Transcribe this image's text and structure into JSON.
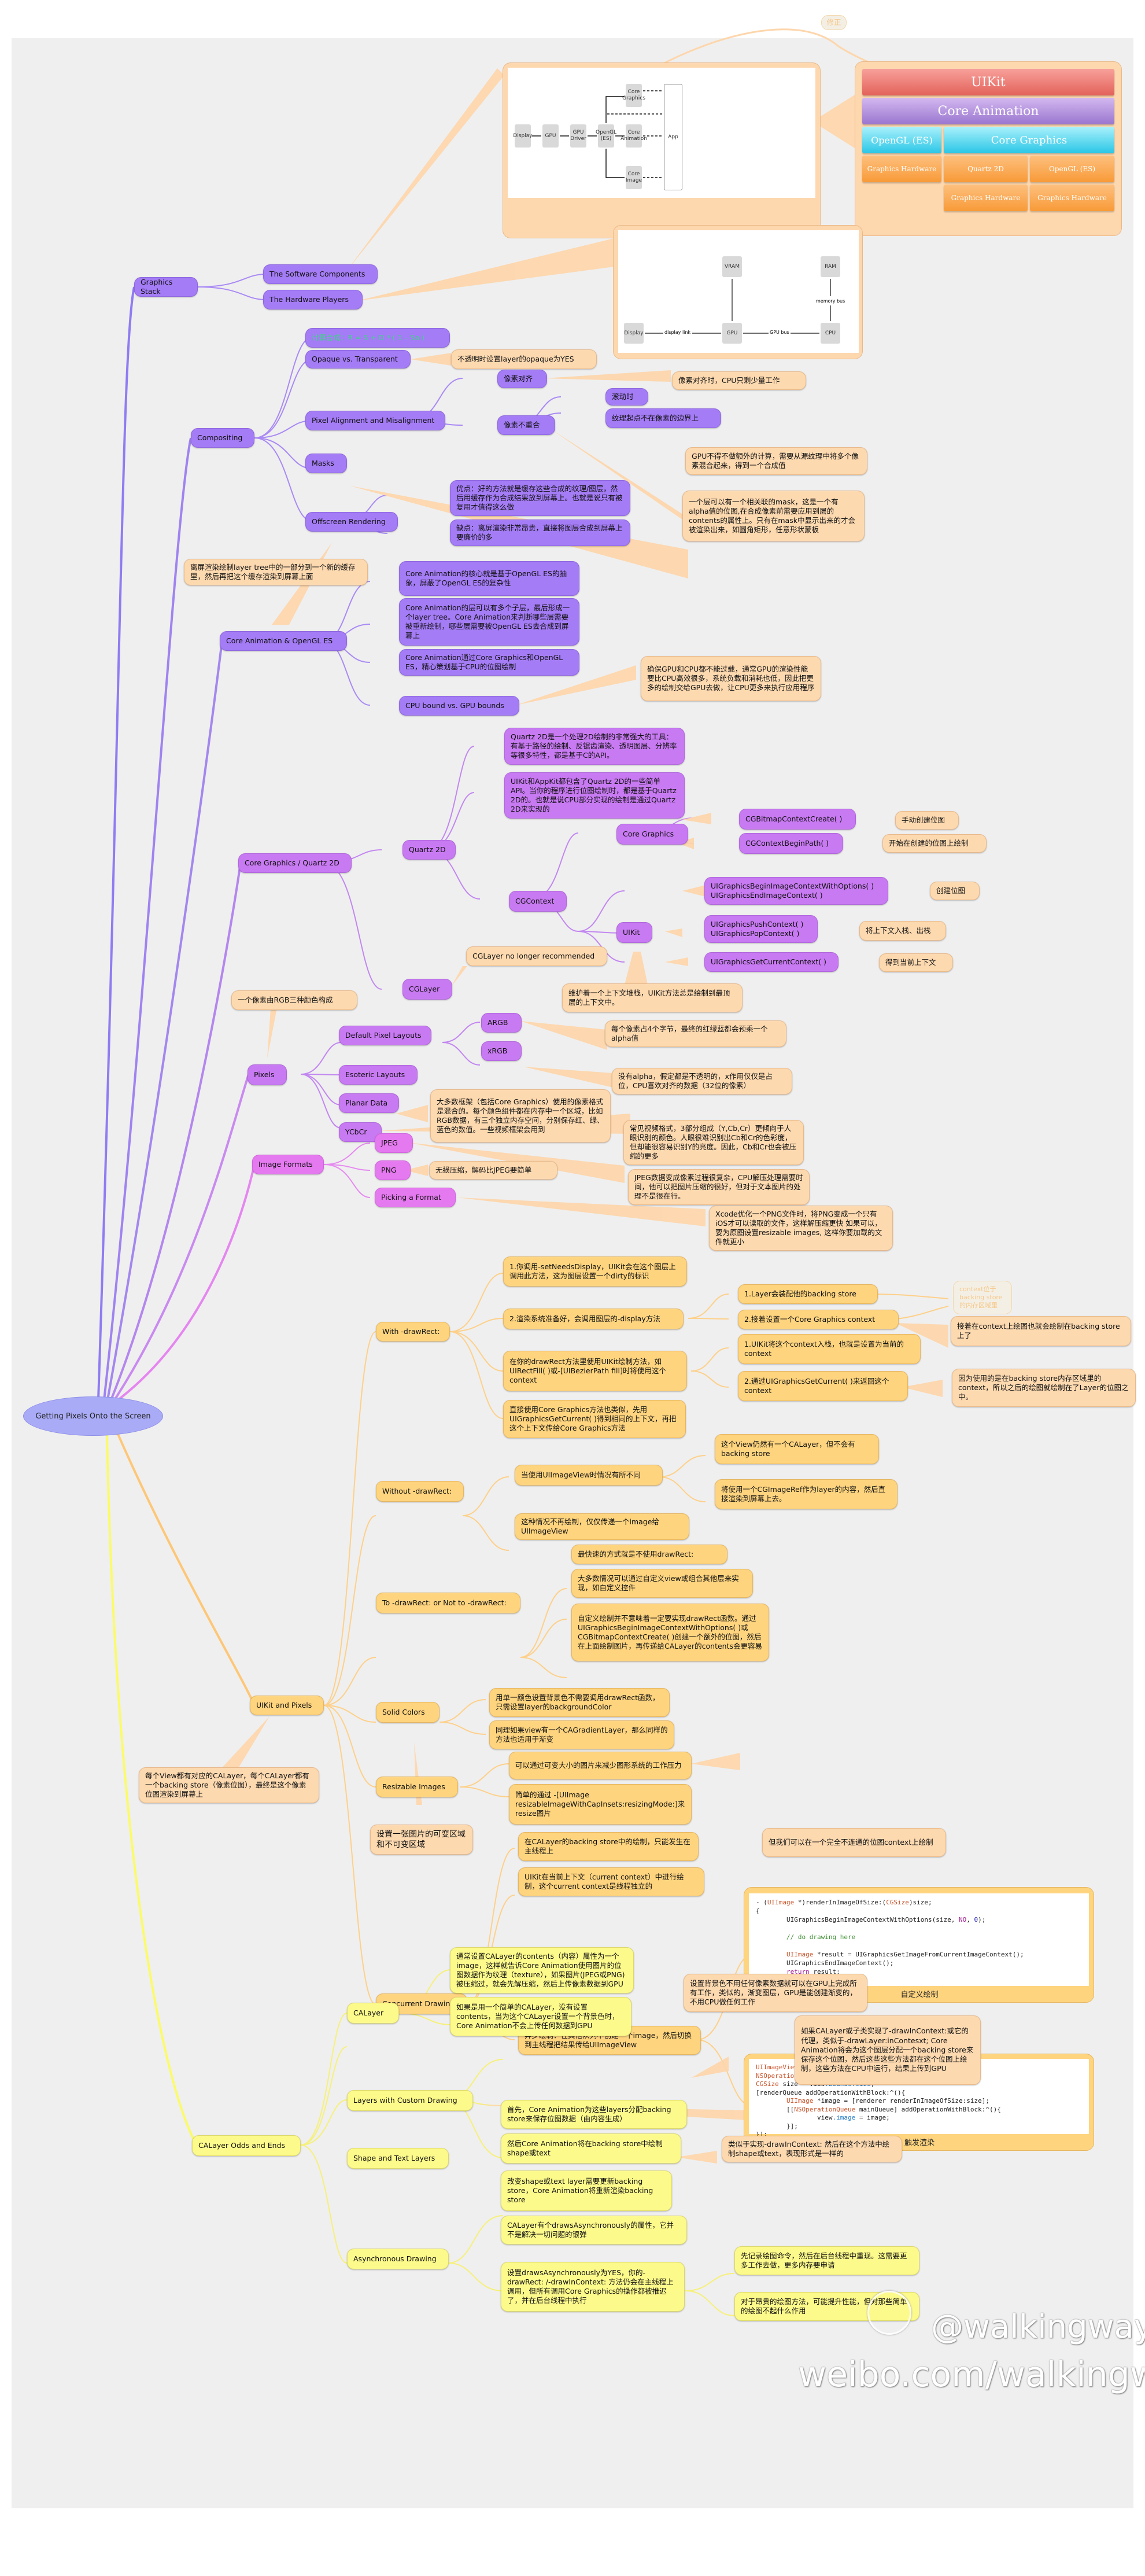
{
  "root": "Getting Pixels Onto the Screen",
  "correction_label": "修正",
  "graphics_stack": {
    "label": "Graphics Stack",
    "software": "The Software Components",
    "hardware": "The Hardware Players",
    "software_diagram": {
      "boxes": [
        "Display",
        "GPU",
        "GPU Driver",
        "OpenGL (ES)",
        "Core Animation",
        "Core Graphics",
        "Core Image",
        "App"
      ]
    },
    "stack_diagram": {
      "uikit": "UIKit",
      "core_animation": "Core Animation",
      "opengl": "OpenGL (ES)",
      "core_graphics": "Core Graphics",
      "gh1": "Graphics Hardware",
      "quartz": "Quartz 2D",
      "opengl2": "OpenGL (ES)",
      "gh2": "Graphics Hardware",
      "gh3": "Graphics Hardware"
    },
    "hardware_diagram": {
      "vram": "VRAM",
      "ram": "RAM",
      "memory_bus": "memory bus",
      "display": "Display",
      "display_link": "display link",
      "gpu": "GPU",
      "gpu_bus": "GPU bus",
      "cpu": "CPU"
    }
  },
  "compositing": {
    "label": "Compositing",
    "formula": "计算合成：R = S + D * ( 1 – Sa )",
    "opaque": "Opaque vs. Transparent",
    "opaque_note": "不透明时设置layer的opaque为YES",
    "pixel_align": "Pixel Alignment and Misalignment",
    "aligned": "像素对齐",
    "aligned_note": "像素对齐时，CPU只剩少量工作",
    "misaligned": "像素不重合",
    "scrolling": "滚动时",
    "texture_edge": "纹理起点不在像素的边界上",
    "misaligned_note": "GPU不得不做额外的计算，需要从源纹理中将多个像素混合起来，得到一个合成值",
    "masks": "Masks",
    "mask_note": "一个层可以有一个相关联的mask，这是一个有alpha值的位图,在合成像素前需要应用到层的contents的属性上。只有在mask中显示出来的才会被渲染出来，如圆角矩形，任意形状蒙板",
    "offscreen": "Offscreen Rendering",
    "offscreen_pro": "优点：好的方法就是缓存这些合成的纹理/图层，然后用缓存作为合成结果放到屏幕上。也就是说只有被复用才值得这么做",
    "offscreen_con": "缺点：离屏渲染非常昂贵，直接将图层合成到屏幕上要廉价的多",
    "offscreen_note": "离屏渲染绘制layer tree中的一部分到一个新的缓存里，然后再把这个缓存渲染到屏幕上面"
  },
  "ca_opengl": {
    "label": "Core Animation & OpenGL ES",
    "item1": "Core Animation的核心就是基于OpenGL ES的抽象，屏蔽了OpenGL ES的复杂性",
    "item2": "Core Animation的层可以有多个子层，最后形成一个layer tree。Core Animation来判断哪些层需要被重新绘制，哪些层需要被OpenGL ES去合成到屏幕上",
    "item3": "Core Animation通过Core Graphics和OpenGL ES，精心策划基于CPU的位图绘制",
    "bound": "CPU bound vs. GPU bounds",
    "bound_note": "确保GPU和CPU都不能过载，通常GPU的渲染性能要比CPU高效很多，系统负载和消耗也低，因此把更多的绘制交给GPU去做，让CPU更多来执行应用程序"
  },
  "core_graphics": {
    "label": "Core Graphics / Quartz 2D",
    "quartz": "Quartz 2D",
    "quartz_note1": "Quartz 2D是一个处理2D绘制的非常强大的工具：有基于路径的绘制、反锯齿渲染、透明图层、分辨率等很多特性，都是基于C的API。",
    "quartz_note2": "UIKit和AppKit都包含了Quartz 2D的一些简单API。当你的程序进行位图绘制时，都是基于Quartz 2D的。也就是说CPU部分实现的绘制是通过Quartz 2D来实现的",
    "cgcontext": "CGContext",
    "cg": "Core Graphics",
    "cg_fn1": "CGBitmapContextCreate( )",
    "cg_fn1_note": "手动创建位图",
    "cg_fn2": "CGContextBeginPath( )",
    "cg_fn2_note": "开始在创建的位图上绘制",
    "uikit": "UIKit",
    "uikit_fn1a": "UIGraphicsBeginImageContextWithOptions( )",
    "uikit_fn1b": "UIGraphicsEndImageContext( )",
    "uikit_fn1_note": "创建位图",
    "uikit_fn2a": "UIGraphicsPushContext( )",
    "uikit_fn2b": "UIGraphicsPopContext( )",
    "uikit_fn2_note": "将上下文入栈、出栈",
    "uikit_fn3": "UIGraphicsGetCurrentContext( )",
    "uikit_fn3_note": "得到当前上下文",
    "uikit_note": "维护着一个上下文堆栈，UIKit方法总是绘制到最顶层的上下文中。",
    "cglayer": "CGLayer",
    "cglayer_note": "CGLayer no longer recommended"
  },
  "pixels": {
    "label": "Pixels",
    "note": "一个像素由RGB三种颜色构成",
    "default": "Default Pixel Layouts",
    "argb": "ARGB",
    "argb_note": "每个像素占4个字节，最终的红绿蓝都会预乘一个alpha值",
    "xrgb": "xRGB",
    "xrgb_note": "没有alpha，假定都是不透明的，x作用仅仅是占位，CPU喜欢对齐的数据（32位的像素）",
    "esoteric": "Esoteric Layouts",
    "planar": "Planar Data",
    "planar_note": "大多数框架（包括Core Graphics）使用的像素格式是混合的。每个颜色组件都在内存中一个区域，比如RGB数据，有三个独立内存空间，分别保存红、绿、蓝色的数值。一些视频框架会用到",
    "ycbcr": "YCbCr",
    "ycbcr_note": "常见视频格式，3部分组成（Y,Cb,Cr）更倾向于人眼识别的颜色。人眼很难识别出Cb和Cr的色彩度，但却能很容易识别Y的亮度。因此，Cb和Cr也会被压缩的更多"
  },
  "image_formats": {
    "label": "Image Formats",
    "jpeg": "JPEG",
    "jpeg_note": "JPEG数据变成像素过程很复杂，CPU解压处理需要时间，他可以把图片压缩的很好，但对于文本图片的处理不是很在行。",
    "png": "PNG",
    "png_note": "无损压缩，解码比JPEG要简单",
    "picking": "Picking a Format",
    "picking_note": "Xcode优化一个PNG文件时，将PNG变成一个只有iOS才可以读取的文件，这样解压缩更快 如果可以，要为原图设置resizable images, 这样你要加载的文件就更小"
  },
  "uikit_pixels": {
    "label": "UIKit and Pixels",
    "note": "每个View都有对应的CALayer，每个CALayer都有一个backing store（像素位图），最终是这个像素位图渲染到屏幕上",
    "with_drawrect": "With -drawRect:",
    "wd1": "1.你调用-setNeedsDisplay，UIKit会在这个图层上调用此方法，这为图层设置一个dirty的标识",
    "wd2": "2.渲染系统准备好，会调用图层的-display方法",
    "wd2a": "1.Layer会装配他的backing store",
    "wd2b": "2.接着设置一个Core Graphics context",
    "wd2_faded": "context位于backing store的内存区域里",
    "wd2b_note": "接着在context上绘图也就会绘制在backing store上了",
    "wd3": "在你的drawRect方法里使用UIKit绘制方法，如UIRectFill( )或-[UIBezierPath fill]时将使用这个context",
    "wd3a": "1.UIKit将这个context入栈，也就是设置为当前的context",
    "wd3b": "2.通过UIGraphicsGetCurrent( )来返回这个context",
    "wd3b_note": "因为使用的是在backing store内存区域里的context，所以之后的绘图就绘制在了Layer的位图之中。",
    "wd4": "直接使用Core Graphics方法也类似，先用UIGraphicsGetCurrent( )得到相同的上下文，再把这个上下文传给Core Graphics方法",
    "without": "Without -drawRect:",
    "wo1": "当使用UIImageView时情况有所不同",
    "wo1a": "这个View仍然有一个CALayer，但不会有backing store",
    "wo1b": "将使用一个CGImageRef作为layer的内容，然后直接渲染到屏幕上去。",
    "wo2": "这种情况不再绘制，仅仅传递一个image给UIImageView",
    "to_or_not": "To -drawRect: or Not to -drawRect:",
    "tn1": "最快速的方式就是不使用drawRect:",
    "tn2": "大多数情况可以通过自定义view或组合其他层来实现，如自定义控件",
    "tn3": "自定义绘制并不意味着一定要实现drawRect函数。通过UIGraphicsBeginImageContextWithOptions( )或CGBitmapContextCreate( )创建一个额外的位图，然后在上面绘制图片，再传递给CALayer的contents会更容易",
    "solid": "Solid Colors",
    "sc1": "用单一颜色设置背景色不需要调用drawRect函数，只需设置layer的backgroundColor",
    "sc2": "同理如果view有一个CAGradientLayer，那么同样的方法也适用于渐变",
    "resizable": "Resizable Images",
    "ri1": "可以通过可变大小的图片来减少图形系统的工作压力",
    "ri2": "简单的通过 -[UIImage resizableImageWithCapInsets:resizingMode:]来resize图片",
    "ri_note": "设置一张图片的可变区域和不可变区域",
    "concurrent": "Concurrent Drawing",
    "cd1": "在CALayer的backing store中的绘制，只能发生在主线程上",
    "cd1_note": "但我们可以在一个完全不连通的位图context上绘制",
    "cd2": "UIKit在当前上下文（current context）中进行绘制，这个current context是线程独立的",
    "cd3": "异步绘制：在其他队列中创建一个image，然后切换到主线程把结果传给UIImageView",
    "code1_caption": "自定义绘制",
    "code2_caption": "触发渲染"
  },
  "calayer_odds": {
    "label": "CALayer Odds and Ends",
    "calayer": "CALayer",
    "cl1": "通常设置CALayer的contents（内容）属性为一个image，这样就告诉Core Animation使用图片的位图数据作为纹理（texture），如果图片(JPEG或PNG)被压缩过，就会先解压缩，然后上传像素数据到GPU",
    "cl2": "如果是用一个简单的CALayer，没有设置contents，当为这个CALayer设置一个背景色时，Core Animation不会上传任何数据到GPU",
    "cl2_note": "设置背景色不用任何像素数据就可以在GPU上完成所有工作，类似的，渐变图层，GPU是能创建渐变的，不用CPU做任何工作",
    "custom": "Layers with Custom Drawing",
    "custom_note": "如果CALayer或子类实现了-drawInContext:或它的代理，类似于-drawLayer:inContesxt; Core Animation将会为这个图层分配一个backing store来保存这个位图，然后这些这些方法都在这个位图上绘制，这些方法在CPU中运行，结果上传到GPU",
    "shape": "Shape and Text Layers",
    "st1": "首先，Core Animation为这些layers分配backing store来保存位图数据（由内容生成）",
    "st2": "然后Core Animation将在backing store中绘制shape或text",
    "st2_note": "类似于实现-drawInContext: 然后在这个方法中绘制shape或text，表现形式是一样的",
    "st3": "改变shape或text layer需要更新backing store，Core Animation将重新渲染backing store",
    "async": "Asynchronous Drawing",
    "ad1": "CALayer有个drawsAsynchronously的属性，它并不是解决一切问题的银弹",
    "ad2": "设置drawsAsynchronously为YES，你的-drawRect: /-drawInContext: 方法仍会在主线程上调用，但所有调用Core Graphics的操作都被推迟了，并在后台线程中执行",
    "ad2a": "先记录绘图命令，然后在后台线程中重现。这需要更多工作去做，更多内存要申请",
    "ad2b": "对于昂贵的绘图方法，可能提升性能，但对那些简单的绘图不起什么作用"
  },
  "watermark": {
    "handle": "@walkingway",
    "url": "weibo.com/walkingway"
  },
  "colors": {
    "purple": "#a47cf5",
    "violet": "#c87af2",
    "magenta": "#e57af0",
    "note_orange": "#fdd9b0",
    "amber": "#fed47f",
    "yellow": "#fdfa8c"
  }
}
